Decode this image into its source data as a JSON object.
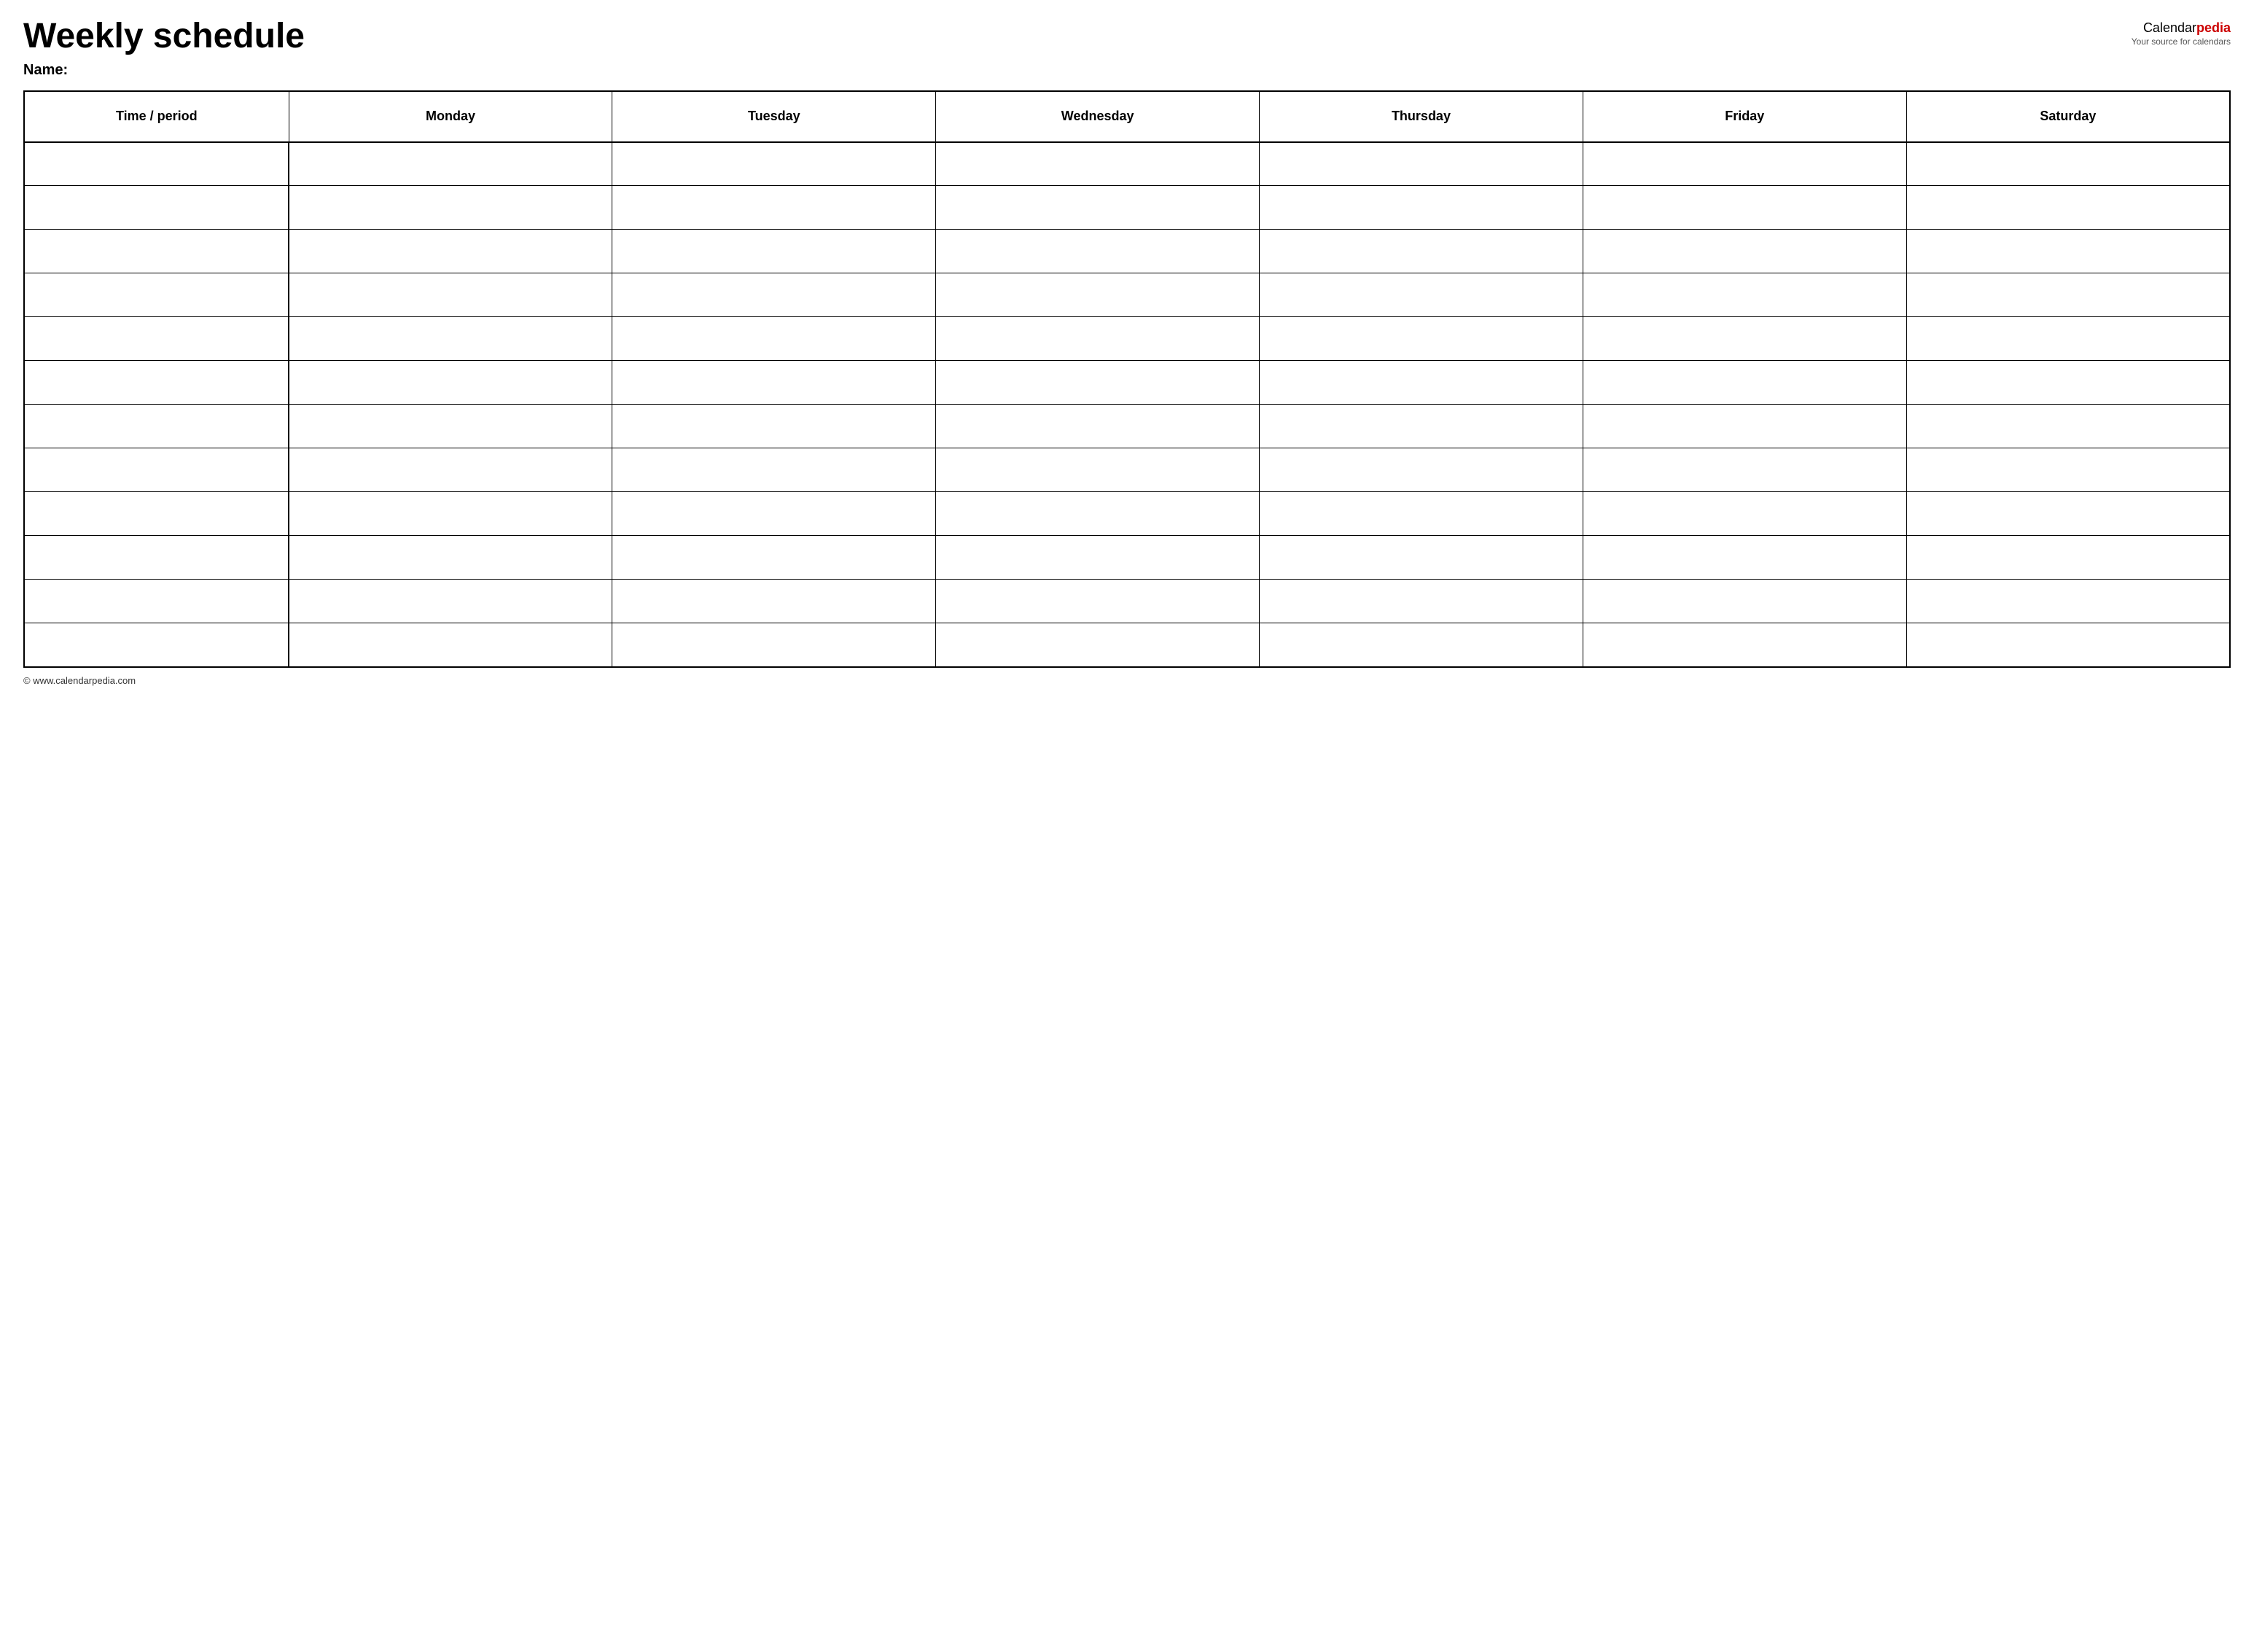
{
  "header": {
    "title": "Weekly schedule",
    "logo": {
      "calendar": "Calendar",
      "pedia": "pedia",
      "subtitle": "Your source for calendars"
    }
  },
  "name_label": "Name:",
  "table": {
    "columns": [
      "Time / period",
      "Monday",
      "Tuesday",
      "Wednesday",
      "Thursday",
      "Friday",
      "Saturday"
    ],
    "rows": 12
  },
  "footer": {
    "text": "© www.calendarpedia.com"
  }
}
